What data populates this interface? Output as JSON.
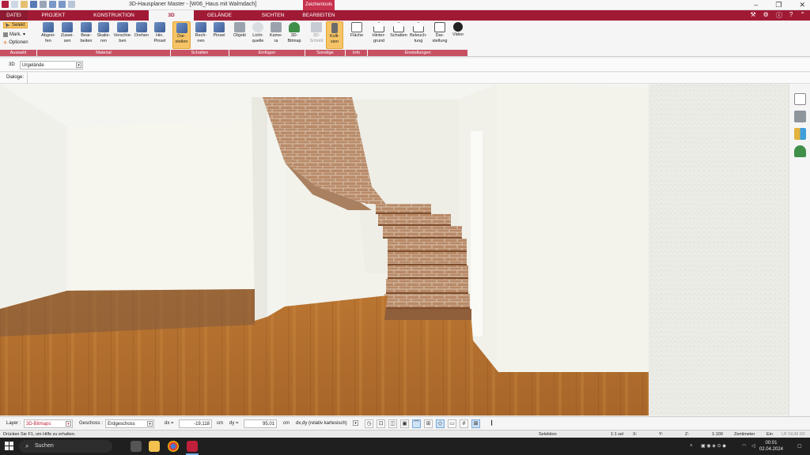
{
  "titlebar": {
    "title": "3D-Hausplaner Master - [W06_Haus mit Walmdach]",
    "context_tab": "Zeichentools",
    "minimize_glyph": "–",
    "restore_glyph": "❐",
    "close_glyph": "✕"
  },
  "menu": {
    "tabs": [
      "DATEI",
      "PROJEKT",
      "KONSTRUKTION",
      "3D",
      "GELÄNDE",
      "SICHTEN",
      "BEARBEITEN"
    ],
    "active": "3D"
  },
  "ribbon": {
    "auswahl": {
      "selekt": "Selekt",
      "mark": "Mark.",
      "optionen": "Optionen",
      "group": "Auswahl"
    },
    "material": {
      "buttons": [
        {
          "label": "Abgrei-\nfen",
          "icon": "eyedropper-icon"
        },
        {
          "label": "Zuwei-\nsen",
          "icon": "paint-bucket-icon"
        },
        {
          "label": "Bear-\nbeiten",
          "icon": "edit-material-icon"
        },
        {
          "label": "Skalie-\nren",
          "icon": "scale-icon"
        },
        {
          "label": "Verschie-\nben",
          "icon": "move-icon"
        },
        {
          "label": "Drehen",
          "icon": "rotate-icon"
        },
        {
          "label": "Hin.\nPinsel",
          "icon": "brush-icon"
        }
      ],
      "group": "Material"
    },
    "schatten": {
      "buttons": [
        {
          "label": "Dar-\nstellen",
          "icon": "shadow-display-icon"
        },
        {
          "label": "Rech-\nnen",
          "icon": "shadow-compute-icon"
        },
        {
          "label": "Pinsel",
          "icon": "shadow-brush-icon"
        }
      ],
      "group": "Schatten"
    },
    "einfuegen": {
      "buttons": [
        {
          "label": "Objekt",
          "icon": "chair-icon"
        },
        {
          "label": "Licht-\nquelle",
          "icon": "lightbulb-icon"
        },
        {
          "label": "Kame-\nra",
          "icon": "camera-icon"
        },
        {
          "label": "3D-\nBitmap",
          "icon": "tree-icon"
        }
      ],
      "group": "Einfügen"
    },
    "sonstige": {
      "buttons": [
        {
          "label": "3D-\nSchnitt",
          "icon": "section-icon"
        },
        {
          "label": "Kolli-\nsion",
          "icon": "collision-icon"
        }
      ],
      "group": "Sonstige"
    },
    "info": {
      "buttons": [
        {
          "label": "Fläche",
          "icon": "area-icon"
        }
      ],
      "group": "Info"
    },
    "einstellungen": {
      "buttons": [
        {
          "label": "Hinter-\ngrund",
          "icon": "background-icon"
        },
        {
          "label": "Schatten",
          "icon": "shadow-settings-icon"
        },
        {
          "label": "Beleuch-\ntung",
          "icon": "lighting-icon"
        },
        {
          "label": "Dar-\nstellung",
          "icon": "display-settings-icon"
        },
        {
          "label": "Video",
          "icon": "video-icon"
        }
      ],
      "group": "Einstellungen"
    }
  },
  "props": {
    "mode_label": "3D",
    "mode_value": "Urgelände",
    "dialoge_label": "Dialoge:"
  },
  "inputbar": {
    "layer_label": "Layer :",
    "layer_value": "3D-Bitmaps",
    "geschoss_label": "Geschoss :",
    "geschoss_value": "Erdgeschoss",
    "dx_label": "dx =",
    "dx_value": "-19,118",
    "dy_label": "dy =",
    "dy_value": "95,01",
    "unit_cm": "cm",
    "mode_value": "dx,dy (relativ kartesisch)"
  },
  "statusbar": {
    "hint": "Drücken Sie F1, um Hilfe zu erhalten.",
    "mode": "Selektion",
    "sel": "1:1 sel",
    "x": "X:",
    "y": "Y:",
    "z": "Z:",
    "scale": "1:100",
    "unit": "Zentimeter",
    "state": "Ein",
    "flags": "UF  NUM  RF"
  },
  "taskbar": {
    "search": "Suchen",
    "time": "00:01",
    "date": "02.04.2024"
  },
  "colors": {
    "brand": "#a11a35",
    "ribbon_group": "#c75163",
    "active_button": "#f6c466"
  }
}
